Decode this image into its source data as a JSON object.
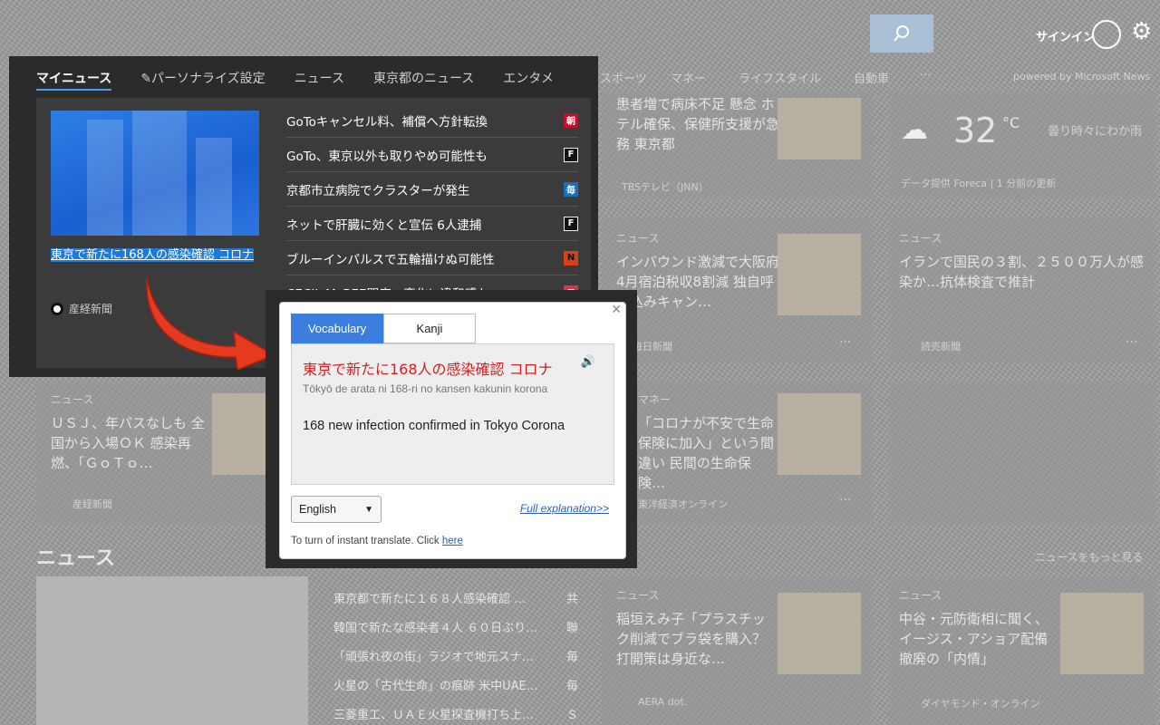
{
  "header": {
    "signin": "サインイン",
    "tabs": [
      {
        "label": "マイニュース"
      },
      {
        "label": "パーソナライズ設定"
      },
      {
        "label": "ニュース"
      },
      {
        "label": "東京都のニュース"
      },
      {
        "label": "エンタメ"
      },
      {
        "label": "スポーツ"
      },
      {
        "label": "マネー"
      },
      {
        "label": "ライフスタイル"
      },
      {
        "label": "自動車"
      }
    ],
    "more": "···",
    "powered": "powered by Microsoft News"
  },
  "flyout": {
    "hero_title": "東京で新たに168人の感染確認 コロナ",
    "hero_source": "産経新聞",
    "list": [
      {
        "title": "GoToキャンセル料、補償へ方針転換",
        "badge": "朝",
        "badge_color": "#c0102a"
      },
      {
        "title": "GoTo、東京以外も取りやめ可能性も",
        "badge": "F",
        "badge_color": "#111111"
      },
      {
        "title": "京都市立病院でクラスターが発生",
        "badge": "毎",
        "badge_color": "#1b6fb8"
      },
      {
        "title": "ネットで肝臓に効くと宣伝 6人逮捕",
        "badge": "F",
        "badge_color": "#111111"
      },
      {
        "title": "ブルーインパルスで五輪描けぬ可能性",
        "badge": "N",
        "badge_color": "#d4401a"
      },
      {
        "title": "CECIL McBEE閉店、変化に違和感も",
        "badge": "T",
        "badge_color": "#e03050"
      }
    ]
  },
  "popup": {
    "tab_vocab": "Vocabulary",
    "tab_kanji": "Kanji",
    "word": "東京で新たに168人の感染確認 コロナ",
    "reading": "Tōkyō de arata ni 168-ri no kansen kakunin korona",
    "translation": "168 new infection confirmed in Tokyo Corona",
    "language": "English",
    "full_link": "Full explanation>>",
    "note": "To turn of instant translate. Click",
    "note_link": "here"
  },
  "background": {
    "card1": {
      "text": "患者増で病床不足 懸念 ホテル確保、保健所支援が急務 東京都",
      "source": "TBSテレビ（JNN）"
    },
    "weather": {
      "temp": "32",
      "unit": "°C",
      "desc": "曇り時々にわか雨",
      "source": "データ提供 Foreca | 1 分前の更新"
    },
    "card2": {
      "label": "ニュース",
      "text": "インバウンド激減で大阪府4月宿泊税収8割減 独自呼び込みキャン…",
      "source": "毎日新聞"
    },
    "card3": {
      "label": "ニュース",
      "text": "イランで国民の３割、２５００万人が感染か…抗体検査で推計",
      "source": "読売新聞"
    },
    "card4": {
      "label": "ニュース",
      "text": "ＵＳＪ、年パスなしも 全国から入場ＯＫ 感染再燃、「ＧｏＴｏ…",
      "source": "産経新聞"
    },
    "card5": {
      "label": "マネー",
      "text": "「コロナが不安で生命保険に加入」という間違い 民間の生命保険…",
      "source": "東洋経済オンライン"
    },
    "section_title": "ニュース",
    "section_more": "ニュースをもっと見る",
    "news_list": [
      {
        "title": "東京都で新たに１６８人感染確認 …",
        "badge": "共"
      },
      {
        "title": "韓国で新たな感染者４人 ６０日ぶり…",
        "badge": "聯"
      },
      {
        "title": "「頑張れ夜の街」ラジオで地元スナ…",
        "badge": "毎"
      },
      {
        "title": "火星の「古代生命」の痕跡 米中UAE…",
        "badge": "毎"
      },
      {
        "title": "三菱重工、ＵＡＥ火星探査機打ち上…",
        "badge": "Ｓ"
      }
    ],
    "card6": {
      "label": "ニュース",
      "text": "稲垣えみ子「プラスチック削減でブラ袋を購入？ 打開策は身近な…",
      "source": "AERA dot."
    },
    "card7": {
      "label": "ニュース",
      "text": "中谷・元防衛相に聞く、イージス・アショア配備撤廃の「内情」",
      "source": "ダイヤモンド・オンライン"
    }
  }
}
